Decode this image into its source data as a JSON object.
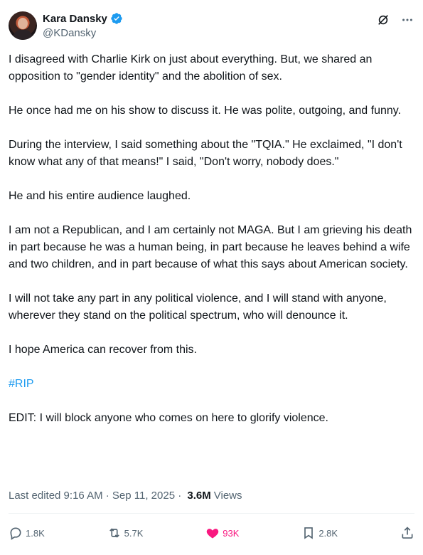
{
  "author": {
    "name": "Kara Dansky",
    "handle": "@KDansky",
    "verified": true
  },
  "paragraphs": [
    "I disagreed with Charlie Kirk on just about everything. But, we shared an opposition to \"gender identity\" and the abolition of sex.",
    "He once had me on his show to discuss it. He was polite, outgoing, and funny.",
    "During the interview, I said something about the \"TQIA.\" He exclaimed, \"I don't know what any of that means!\" I said, \"Don't worry, nobody does.\"",
    "He and his entire audience laughed.",
    "I am not a Republican, and I am certainly not MAGA. But I am grieving his death in part because he was a human being, in part because he leaves behind a wife and two children, and in part because of what this says about American society.",
    "I will not take any part in any political violence, and I will stand with anyone, wherever they stand on the political spectrum, who will denounce it.",
    "I hope America can recover from this."
  ],
  "hashtag": "#RIP",
  "edit_note": "EDIT: I will block anyone who comes on here to glorify violence.",
  "meta": {
    "edited": "Last edited 9:16 AM · Sep 11, 2025 · ",
    "views_count": "3.6M",
    "views_label": "Views"
  },
  "actions": {
    "replies": "1.8K",
    "reposts": "5.7K",
    "likes": "93K",
    "bookmarks": "2.8K"
  },
  "icons": {
    "header": [
      "grok-icon",
      "more-icon"
    ],
    "actions": [
      "reply-icon",
      "repost-icon",
      "heart-icon",
      "bookmark-icon",
      "share-icon"
    ]
  },
  "colors": {
    "accent": "#1d9bf0",
    "like": "#f91880",
    "muted": "#536471",
    "text": "#0f1419"
  }
}
